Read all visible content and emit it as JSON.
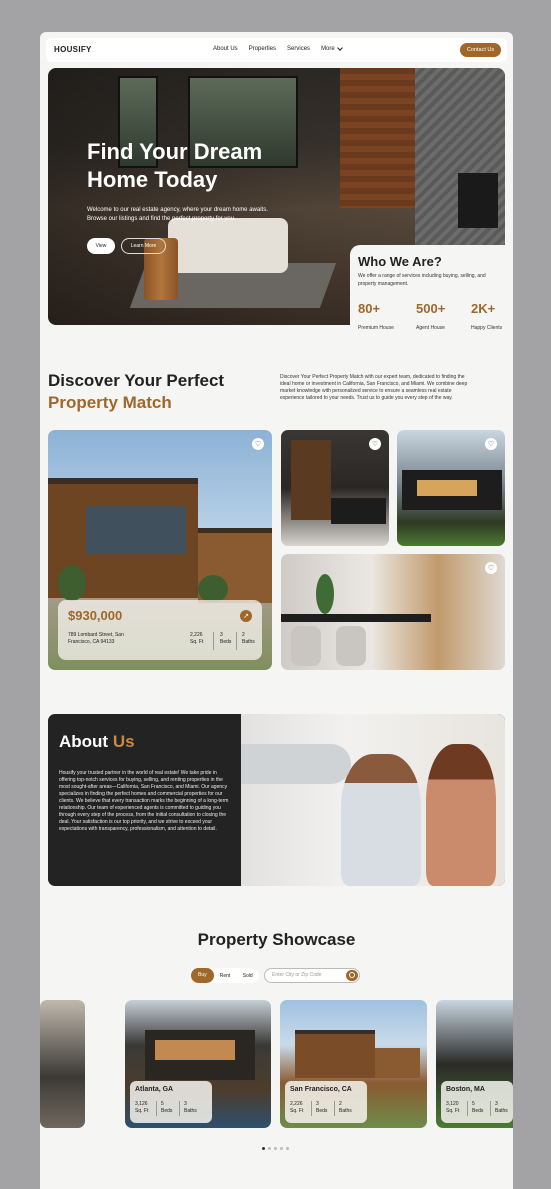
{
  "nav": {
    "logo": "HOUSIFY",
    "items": [
      "About Us",
      "Properties",
      "Services",
      "More"
    ],
    "contact": "Contact Us"
  },
  "hero": {
    "title": "Find Your Dream Home Today",
    "subtitle": "Welcome to our real estate agency, where your dream home awaits. Browse our listings and find the perfect property for you.",
    "view": "View",
    "learn": "Learn More"
  },
  "who": {
    "title": "Who We Are?",
    "text": "We offer a range of services including buying, selling, and property management.",
    "stats": [
      {
        "value": "80+",
        "label": "Premium House"
      },
      {
        "value": "500+",
        "label": "Agent House"
      },
      {
        "value": "2K+",
        "label": "Happy Clients"
      }
    ]
  },
  "discover": {
    "title1": "Discover Your Perfect",
    "title2": "Property Match",
    "text": "Discover Your Perfect Property Match with our expert team, dedicated to finding the ideal home or investment in California, San Francisco, and Miami. We combine deep market knowledge with personalized service to ensure a seamless real estate experience tailored to your needs. Trust us to guide you every step of the way."
  },
  "featured": {
    "price": "$930,000",
    "address": "789 Lombard Street, San Francisco, CA 94133",
    "sqft": "2,226",
    "sqft_label": "Sq. Ft",
    "beds": "3",
    "beds_label": "Beds",
    "baths": "2",
    "baths_label": "Baths"
  },
  "about": {
    "title_a": "About",
    "title_b": "Us",
    "text": "Housify your trusted partner in the world of real estate! We take pride in offering top-notch services for buying, selling, and renting properties in the most sought-after areas—California, San Francisco, and Miami. Our agency specializes in finding the perfect homes and commercial properties for our clients. We believe that every transaction marks the beginning of a long-term relationship. Our team of experienced agents is committed to guiding you through every step of the process, from the initial consultation to closing the deal. Your satisfaction is our top priority, and we strive to exceed your expectations with transparency, professionalism, and attention to detail."
  },
  "showcase": {
    "title": "Property Showcase",
    "tabs": [
      "Buy",
      "Rent",
      "Sold"
    ],
    "search_placeholder": "Enter City or Zip Code",
    "cards": [
      {
        "city": "Atlanta, GA",
        "sqft": "3,126",
        "beds": "5",
        "baths": "3"
      },
      {
        "city": "San Francisco, CA",
        "sqft": "2,226",
        "beds": "3",
        "baths": "2"
      },
      {
        "city": "Boston, MA",
        "sqft": "3,120",
        "beds": "5",
        "baths": "3"
      }
    ],
    "sqft_label": "Sq. Ft",
    "beds_label": "Beds",
    "baths_label": "Baths"
  },
  "colors": {
    "accent": "#a0672a",
    "dark": "#232323",
    "bg": "#f5f5f4"
  }
}
